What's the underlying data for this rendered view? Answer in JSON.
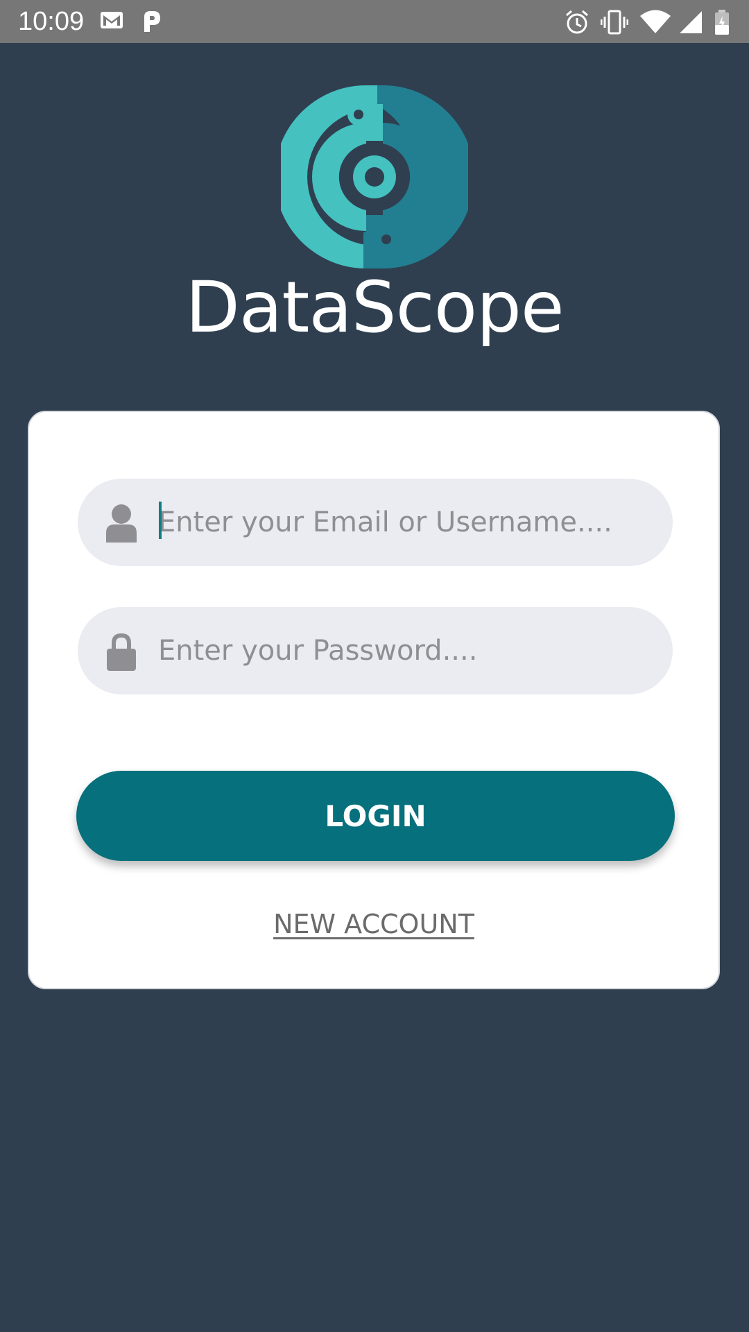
{
  "status_bar": {
    "time": "10:09",
    "icons": [
      "gmail-icon",
      "parking-icon",
      "alarm-icon",
      "vibrate-icon",
      "wifi-icon",
      "signal-icon",
      "battery-icon"
    ]
  },
  "brand": {
    "name": "DataScope",
    "colors": {
      "teal_light": "#45c1c0",
      "teal_dark": "#227f91"
    }
  },
  "login_form": {
    "email_placeholder": "Enter your Email or Username....",
    "email_value": "",
    "password_placeholder": "Enter your Password....",
    "password_value": "",
    "login_label": "LOGIN",
    "new_account_label": "NEW ACCOUNT"
  },
  "colors": {
    "background": "#2f3f50",
    "primary_button": "#06707c",
    "field_background": "#ebecf1"
  }
}
